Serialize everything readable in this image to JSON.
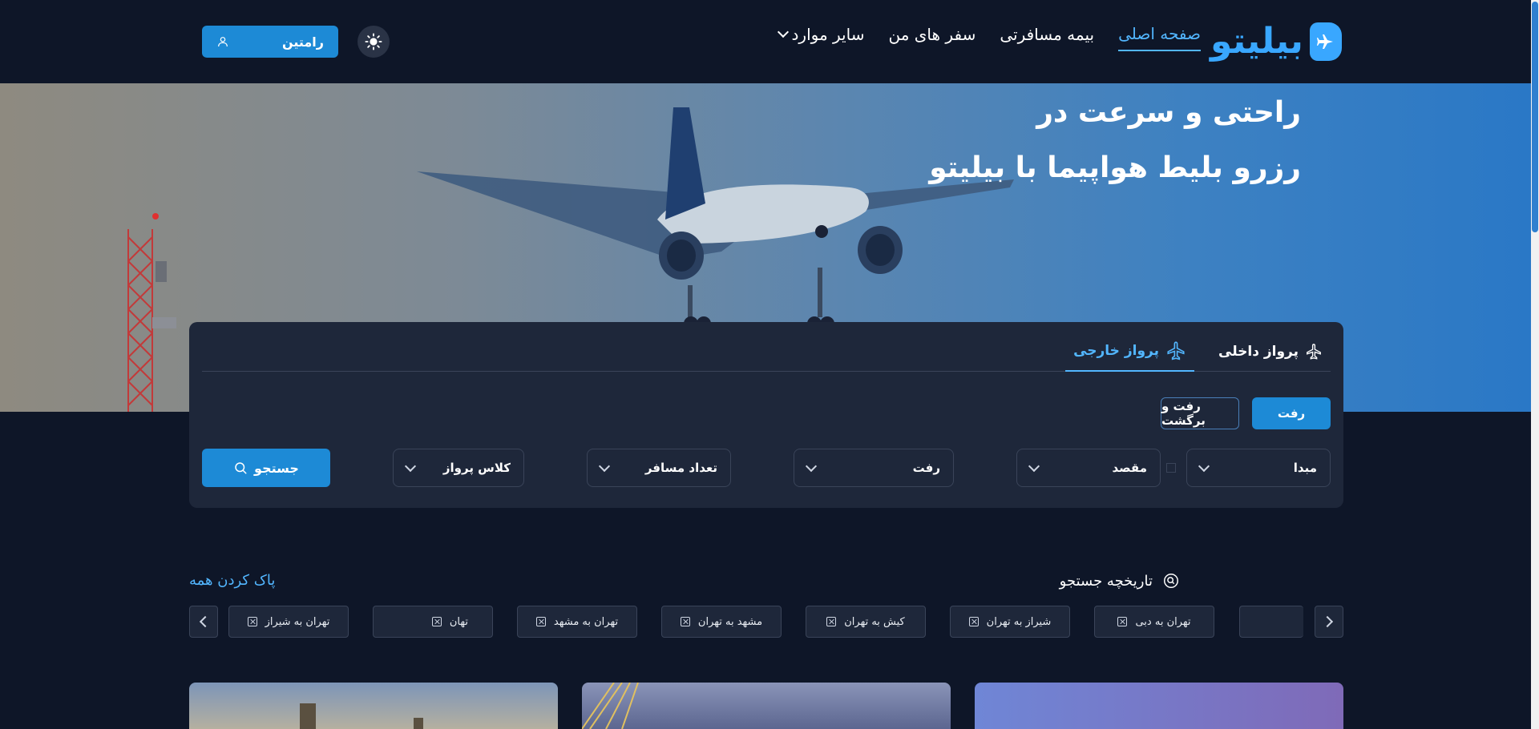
{
  "header": {
    "logo_text": "بیلیتو",
    "nav": [
      {
        "label": "صفحه اصلی",
        "active": true
      },
      {
        "label": "بیمه مسافرتی",
        "active": false
      },
      {
        "label": "سفر های من",
        "active": false
      },
      {
        "label": "سایر موارد",
        "active": false
      }
    ],
    "login_label": "رامتین"
  },
  "hero": {
    "line1": "راحتی و سرعت در",
    "line2": "رزرو بلیط هواپیما با بیلیتو"
  },
  "search": {
    "tabs": [
      {
        "label": "پرواز داخلی",
        "active": false
      },
      {
        "label": "پرواز خارجی",
        "active": true
      }
    ],
    "trip_types": [
      {
        "label": "رفت",
        "active": true
      },
      {
        "label": "رفت و برگشت",
        "active": false
      }
    ],
    "fields": {
      "origin": "مبدا",
      "destination": "مقصد",
      "departure": "رفت",
      "passengers": "تعداد مسافر",
      "cabin_class": "کلاس پرواز"
    },
    "search_label": "جستجو"
  },
  "history": {
    "title": "تاریخچه جستجو",
    "clear_all": "پاک کردن همه",
    "items": [
      "تهران به دبی",
      "شیراز به تهران",
      "کیش به تهران",
      "مشهد به تهران",
      "تهران به مشهد",
      "تهان",
      "تهران به شیراز"
    ]
  },
  "colors": {
    "background": "#0e1628",
    "panel": "#1e273a",
    "accent": "#1d8ad6",
    "accent_text": "#52b6ff"
  }
}
